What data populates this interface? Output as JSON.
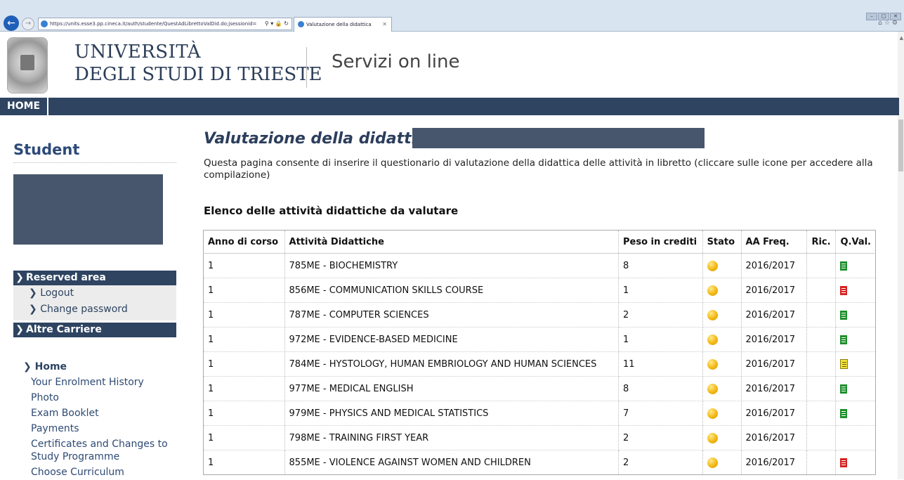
{
  "browser": {
    "url": "https://units.esse3.pp.cineca.it/auth/studente/QuestAdLibrettoValDid.do;jsessionid=",
    "tab_title": "Valutazione della didattica"
  },
  "header": {
    "university_line1": "UNIVERSITÀ",
    "university_line2": "DEGLI STUDI DI TRIESTE",
    "service_title": "Servizi on line"
  },
  "navbar": {
    "home_label": "HOME"
  },
  "sidebar": {
    "title": "Student",
    "reserved_area": "Reserved area",
    "reserved_links": [
      "Logout",
      "Change password"
    ],
    "other_careers": "Altre Carriere",
    "home_link": "Home",
    "links": [
      "Your Enrolment History",
      "Photo",
      "Exam Booklet",
      "Payments",
      "Certificates and Changes to Study Programme",
      "Choose Curriculum"
    ]
  },
  "main": {
    "title": "Valutazione della didattica",
    "intro": "Questa pagina consente di inserire il questionario di valutazione della didattica delle attività in libretto (cliccare sulle icone per accedere alla compilazione)",
    "list_heading": "Elenco delle attività didattiche da valutare",
    "table": {
      "columns": [
        "Anno di corso",
        "Attività Didattiche",
        "Peso in crediti",
        "Stato",
        "AA Freq.",
        "Ric.",
        "Q.Val."
      ],
      "rows": [
        {
          "anno": "1",
          "attivita": "785ME - BIOCHEMISTRY",
          "crediti": "8",
          "stato": "yellow-circle",
          "aa": "2016/2017",
          "ric": "",
          "qval": "green-document-icon"
        },
        {
          "anno": "1",
          "attivita": "856ME - COMMUNICATION SKILLS COURSE",
          "crediti": "1",
          "stato": "yellow-circle",
          "aa": "2016/2017",
          "ric": "",
          "qval": "red-document-icon"
        },
        {
          "anno": "1",
          "attivita": "787ME - COMPUTER SCIENCES",
          "crediti": "2",
          "stato": "yellow-circle",
          "aa": "2016/2017",
          "ric": "",
          "qval": "green-document-icon"
        },
        {
          "anno": "1",
          "attivita": "972ME - EVIDENCE-BASED MEDICINE",
          "crediti": "1",
          "stato": "yellow-circle",
          "aa": "2016/2017",
          "ric": "",
          "qval": "green-document-icon"
        },
        {
          "anno": "1",
          "attivita": "784ME - HYSTOLOGY, HUMAN EMBRIOLOGY AND HUMAN SCIENCES",
          "crediti": "11",
          "stato": "yellow-circle",
          "aa": "2016/2017",
          "ric": "",
          "qval": "yellow-document-icon"
        },
        {
          "anno": "1",
          "attivita": "977ME - MEDICAL ENGLISH",
          "crediti": "8",
          "stato": "yellow-circle",
          "aa": "2016/2017",
          "ric": "",
          "qval": "green-document-icon"
        },
        {
          "anno": "1",
          "attivita": "979ME - PHYSICS AND MEDICAL STATISTICS",
          "crediti": "7",
          "stato": "yellow-circle",
          "aa": "2016/2017",
          "ric": "",
          "qval": "green-document-icon"
        },
        {
          "anno": "1",
          "attivita": "798ME - TRAINING FIRST YEAR",
          "crediti": "2",
          "stato": "yellow-circle",
          "aa": "2016/2017",
          "ric": "",
          "qval": ""
        },
        {
          "anno": "1",
          "attivita": "855ME - VIOLENCE AGAINST WOMEN AND CHILDREN",
          "crediti": "2",
          "stato": "yellow-circle",
          "aa": "2016/2017",
          "ric": "",
          "qval": "red-document-icon"
        }
      ]
    }
  },
  "colors": {
    "nav_bg": "#2e4461",
    "title_color": "#2c3e5c",
    "redaction": "#47566d"
  }
}
